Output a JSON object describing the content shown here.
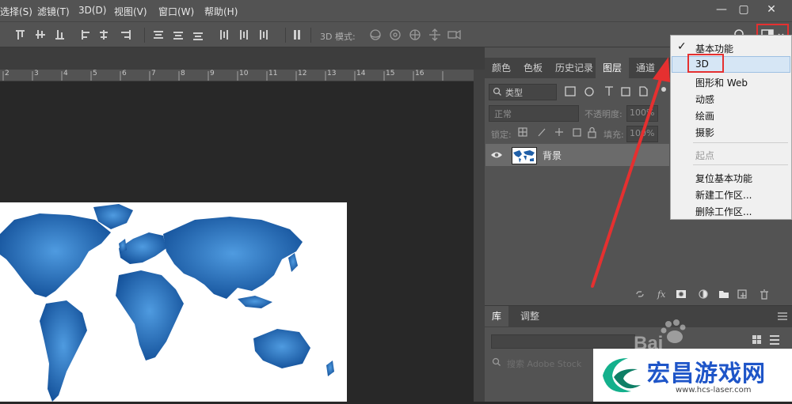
{
  "menubar": {
    "items": [
      "选择(S)",
      "滤镜(T)",
      "3D(D)",
      "视图(V)",
      "窗口(W)",
      "帮助(H)"
    ]
  },
  "window": {
    "minimize_icon": "—",
    "restore_icon": "▢",
    "close_icon": "✕"
  },
  "optionsbar": {
    "mode_label": "3D 模式:"
  },
  "ruler": {
    "ticks": [
      "2",
      "3",
      "4",
      "5",
      "6",
      "7",
      "8",
      "9",
      "10",
      "11",
      "12",
      "13",
      "14",
      "15",
      "16"
    ]
  },
  "panel": {
    "tabs": [
      "颜色",
      "色板",
      "历史记录",
      "图层",
      "通道"
    ],
    "active_tab": "图层",
    "filter_label": "类型",
    "blend_mode": "正常",
    "opacity_label": "不透明度:",
    "opacity_value": "100%",
    "lock_label": "锁定:",
    "fill_label": "填充:",
    "fill_value": "100%",
    "layer_name": "背景",
    "lib_tabs": [
      "库",
      "调整"
    ],
    "search_placeholder": "搜索 Adobe Stock"
  },
  "workspace_menu": {
    "items": [
      {
        "label": "基本功能",
        "checked": true
      },
      {
        "label": "3D",
        "highlighted": true
      },
      {
        "label": "图形和 Web"
      },
      {
        "label": "动感"
      },
      {
        "label": "绘画"
      },
      {
        "label": "摄影"
      }
    ],
    "disabled_item": "起点",
    "actions": [
      "复位基本功能",
      "新建工作区...",
      "删除工作区..."
    ]
  },
  "watermark": {
    "title": "宏昌游戏网",
    "url": "www.hcs-laser.com"
  },
  "colors": {
    "ui_dark": "#535353",
    "canvas_bg": "#282828",
    "highlight_red": "#e53030",
    "map_blue": "#1f5fa8"
  }
}
